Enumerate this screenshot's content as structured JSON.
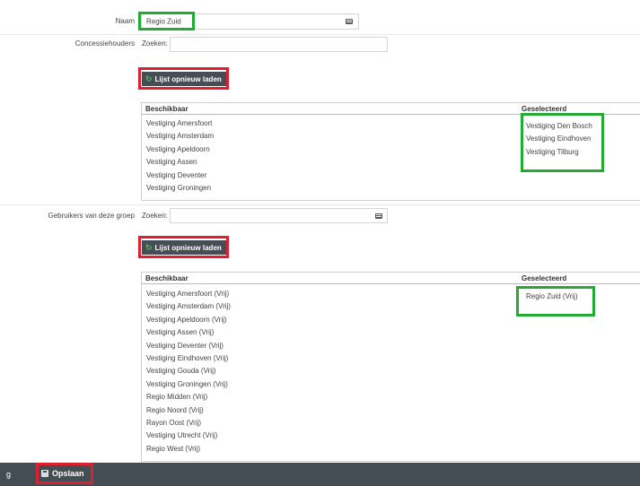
{
  "form": {
    "name": {
      "label": "Naam",
      "value": "Regio Zuid"
    },
    "concessiehouders": {
      "label": "Concessiehouders",
      "search_placeholder": "Zoeken:",
      "reload_label": "Lijst opnieuw laden",
      "available_header": "Beschikbaar",
      "selected_header": "Geselecteerd",
      "available": [
        "Vestiging Amersfoort",
        "Vestiging Amsterdam",
        "Vestiging Apeldoorn",
        "Vestiging Assen",
        "Vestiging Deventer",
        "Vestiging Groningen"
      ],
      "selected": [
        "Vestiging Den Bosch",
        "Vestiging Eindhoven",
        "Vestiging Tilburg"
      ]
    },
    "gebruikers": {
      "label": "Gebruikers van deze groep",
      "search_placeholder": "Zoeken:",
      "reload_label": "Lijst opnieuw laden",
      "available_header": "Beschikbaar",
      "selected_header": "Geselecteerd",
      "available": [
        "Vestiging Amersfoort (Vrij)",
        "Vestiging Amsterdam (Vrij)",
        "Vestiging Apeldoorn (Vrij)",
        "Vestiging Assen (Vrij)",
        "Vestiging Deventer (Vrij)",
        "Vestiging Eindhoven (Vrij)",
        "Vestiging Gouda (Vrij)",
        "Vestiging Groningen (Vrij)",
        "Regio Midden (Vrij)",
        "Regio Noord (Vrij)",
        "Rayon Oost (Vrij)",
        "Vestiging Utrecht (Vrij)",
        "Regio West (Vrij)"
      ],
      "selected": [
        "Regio Zuid (Vrij)"
      ]
    }
  },
  "footer": {
    "left_text": "g",
    "save_label": "Opslaan"
  },
  "colors": {
    "highlight_green": "#22aa33",
    "highlight_red": "#dd1f2e",
    "button_dark": "#464d55",
    "footer_bar": "#454d54"
  }
}
